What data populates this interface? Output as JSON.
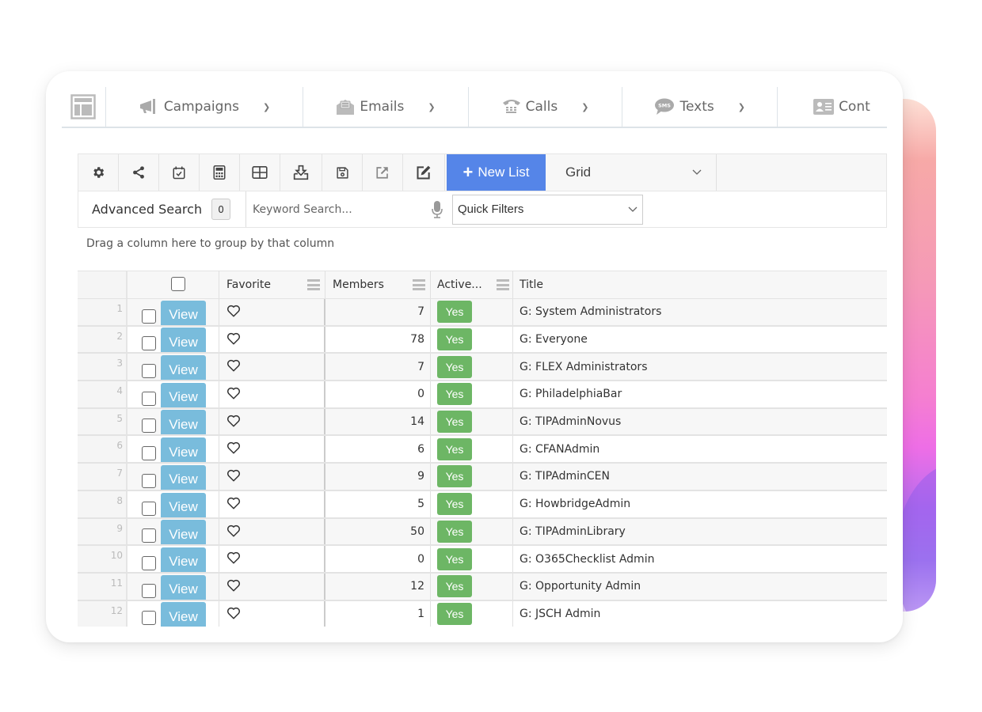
{
  "nav": {
    "items": [
      {
        "label": "Campaigns",
        "icon": "megaphone-icon"
      },
      {
        "label": "Emails",
        "icon": "open-envelope-icon"
      },
      {
        "label": "Calls",
        "icon": "telephone-icon"
      },
      {
        "label": "Texts",
        "icon": "sms-bubble-icon"
      },
      {
        "label": "Cont",
        "icon": "contact-card-icon"
      }
    ]
  },
  "toolbar": {
    "icons": [
      "gear-icon",
      "share-icon",
      "calendar-check-icon",
      "calculator-icon",
      "table-icon",
      "download-tray-icon",
      "save-icon",
      "external-link-icon",
      "edit-icon"
    ],
    "new_list_label": "New List",
    "view_select": "Grid"
  },
  "search": {
    "advanced_label": "Advanced Search",
    "advanced_count": "0",
    "keyword_placeholder": "Keyword Search...",
    "keyword_value": "",
    "quick_filters": "Quick Filters"
  },
  "grouping_hint": "Drag a column here to group by that column",
  "grid": {
    "columns": [
      "Favorite",
      "Members",
      "Active...",
      "Title"
    ],
    "view_label": "View",
    "rows": [
      {
        "num": "1",
        "members": "7",
        "active": "Yes",
        "title": "G: System Administrators"
      },
      {
        "num": "2",
        "members": "78",
        "active": "Yes",
        "title": "G: Everyone"
      },
      {
        "num": "3",
        "members": "7",
        "active": "Yes",
        "title": "G: FLEX Administrators"
      },
      {
        "num": "4",
        "members": "0",
        "active": "Yes",
        "title": "G: PhiladelphiaBar"
      },
      {
        "num": "5",
        "members": "14",
        "active": "Yes",
        "title": "G: TIPAdminNovus"
      },
      {
        "num": "6",
        "members": "6",
        "active": "Yes",
        "title": "G: CFANAdmin"
      },
      {
        "num": "7",
        "members": "9",
        "active": "Yes",
        "title": "G: TIPAdminCEN"
      },
      {
        "num": "8",
        "members": "5",
        "active": "Yes",
        "title": "G: HowbridgeAdmin"
      },
      {
        "num": "9",
        "members": "50",
        "active": "Yes",
        "title": "G: TIPAdminLibrary"
      },
      {
        "num": "10",
        "members": "0",
        "active": "Yes",
        "title": "G: O365Checklist Admin"
      },
      {
        "num": "11",
        "members": "12",
        "active": "Yes",
        "title": "G: Opportunity Admin"
      },
      {
        "num": "12",
        "members": "1",
        "active": "Yes",
        "title": "G: JSCH Admin"
      }
    ]
  },
  "colors": {
    "primary": "#5585e8",
    "view_button": "#79bcdc",
    "active_badge": "#6db665"
  }
}
